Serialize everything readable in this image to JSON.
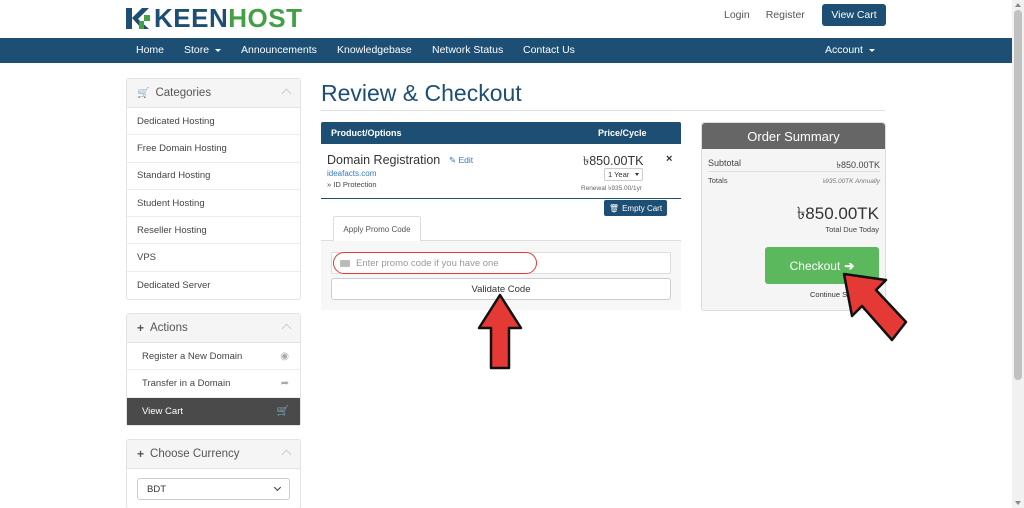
{
  "header": {
    "logo_keen": "KEEN",
    "logo_host": "HOST",
    "login": "Login",
    "register": "Register",
    "view_cart": "View Cart"
  },
  "nav": {
    "home": "Home",
    "store": "Store",
    "announcements": "Announcements",
    "knowledgebase": "Knowledgebase",
    "network_status": "Network Status",
    "contact_us": "Contact Us",
    "account": "Account"
  },
  "sidebar": {
    "categories": {
      "title": "Categories",
      "items": [
        "Dedicated Hosting",
        "Free Domain Hosting",
        "Standard Hosting",
        "Student Hosting",
        "Reseller Hosting",
        "VPS",
        "Dedicated Server"
      ]
    },
    "actions": {
      "title": "Actions",
      "items": [
        "Register a New Domain",
        "Transfer in a Domain",
        "View Cart"
      ]
    },
    "currency": {
      "title": "Choose Currency",
      "selected": "BDT"
    }
  },
  "main": {
    "title": "Review & Checkout",
    "table": {
      "col_product": "Product/Options",
      "col_price": "Price/Cycle"
    },
    "item": {
      "name": "Domain Registration",
      "edit": "Edit",
      "domain": "ideafacts.com",
      "addon": "» ID Protection",
      "price": "৳850.00TK",
      "cycle": "1 Year",
      "renewal": "Renewal ৳935.00/1yr",
      "remove": "×"
    },
    "empty_cart": "Empty Cart",
    "promo": {
      "tab": "Apply Promo Code",
      "placeholder": "Enter promo code if you have one",
      "validate": "Validate Code"
    }
  },
  "summary": {
    "title": "Order Summary",
    "subtotal_label": "Subtotal",
    "subtotal_value": "৳850.00TK",
    "totals_label": "Totals",
    "totals_value": "৳935.00TK Annually",
    "total_due": "৳850.00TK",
    "total_due_label": "Total Due Today",
    "checkout": "Checkout",
    "continue": "Continue Shopping"
  },
  "colors": {
    "brand_blue": "#1d4e74",
    "brand_green": "#43a047",
    "checkout_green": "#5cb85c",
    "annotation_red": "#e53935"
  }
}
